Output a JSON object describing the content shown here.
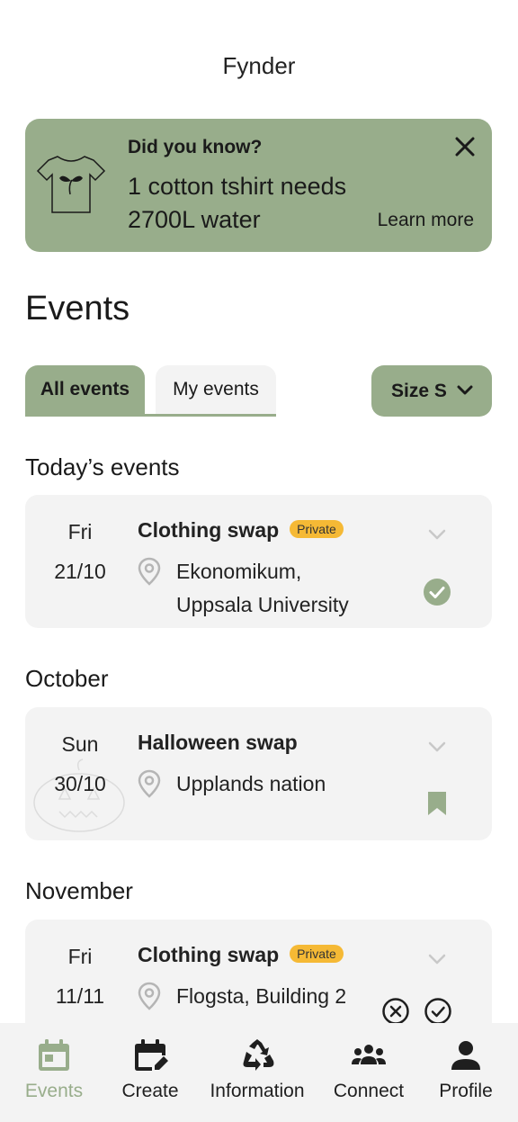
{
  "app": {
    "title": "Fynder"
  },
  "banner": {
    "title": "Did you know?",
    "line1": "1 cotton tshirt needs",
    "line2": "2700L water",
    "learn_more": "Learn more",
    "icons": {
      "illustration": "tshirt-plant-icon",
      "close": "close-icon"
    }
  },
  "events_page": {
    "title": "Events",
    "tabs": [
      {
        "label": "All events",
        "active": true
      },
      {
        "label": "My events",
        "active": false
      }
    ],
    "size_filter": {
      "label": "Size S",
      "icon": "chevron-down-icon"
    }
  },
  "groups": [
    {
      "title": "Today’s events",
      "events": [
        {
          "weekday": "Fri",
          "date": "21/10",
          "name": "Clothing swap",
          "badge": "Private",
          "location_line1": "Ekonomikum,",
          "location_line2": "Uppsala University",
          "status_icon": "check-circle-icon"
        }
      ]
    },
    {
      "title": "October",
      "events": [
        {
          "weekday": "Sun",
          "date": "30/10",
          "name": "Halloween swap",
          "location_line1": "Upplands nation",
          "status_icon": "bookmark-icon",
          "decoration_icon": "pumpkin-icon"
        }
      ]
    },
    {
      "title": "November",
      "events": [
        {
          "weekday": "Fri",
          "date": "11/11",
          "name": "Clothing swap",
          "badge": "Private",
          "location_line1": "Flogsta, Building 2",
          "actions": [
            "decline-circle-icon",
            "accept-circle-icon"
          ]
        }
      ]
    }
  ],
  "nav": [
    {
      "label": "Events",
      "icon": "calendar-icon",
      "active": true
    },
    {
      "label": "Create",
      "icon": "calendar-edit-icon",
      "active": false
    },
    {
      "label": "Information",
      "icon": "recycle-icon",
      "active": false
    },
    {
      "label": "Connect",
      "icon": "people-icon",
      "active": false
    },
    {
      "label": "Profile",
      "icon": "person-icon",
      "active": false
    }
  ],
  "colors": {
    "accent": "#98ad8b",
    "card": "#f3f3f3",
    "badge": "#f5b935",
    "text": "#1f1f1f"
  }
}
